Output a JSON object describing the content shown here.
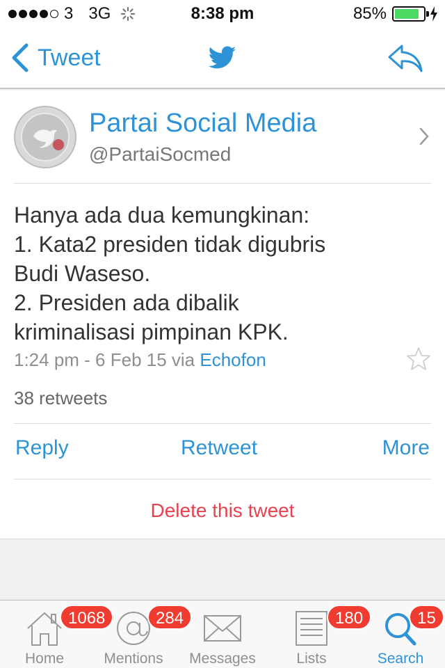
{
  "status_bar": {
    "carrier": "3",
    "network": "3G",
    "time": "8:38 pm",
    "battery_percent": "85%",
    "battery_level": 0.85
  },
  "nav": {
    "back_label": "Tweet",
    "center_icon": "twitter-bird-icon",
    "right_icon": "reply-arrow-icon"
  },
  "tweet": {
    "display_name": "Partai Social Media",
    "handle": "@PartaiSocmed",
    "text_lines": [
      "Hanya ada dua kemungkinan:",
      "1. Kata2 presiden tidak digubris",
      "Budi Waseso.",
      "2. Presiden ada dibalik",
      "kriminalisasi pimpinan KPK."
    ],
    "timestamp": "1:24 pm - 6 Feb 15 via",
    "source": "Echofon",
    "retweets": "38 retweets"
  },
  "actions": {
    "reply": "Reply",
    "retweet": "Retweet",
    "more": "More",
    "delete": "Delete this tweet"
  },
  "tab_bar": {
    "tabs": [
      {
        "label": "Home",
        "badge": "1068",
        "icon": "home-icon"
      },
      {
        "label": "Mentions",
        "badge": "284",
        "icon": "at-sign-icon"
      },
      {
        "label": "Messages",
        "badge": "",
        "icon": "envelope-icon"
      },
      {
        "label": "Lists",
        "badge": "180",
        "icon": "list-icon"
      },
      {
        "label": "Search",
        "badge": "15",
        "icon": "search-icon"
      }
    ],
    "active": "Search"
  },
  "colors": {
    "accent": "#2d93d6",
    "delete": "#e8424f",
    "badge": "#f03b30",
    "battery": "#4cd964"
  }
}
